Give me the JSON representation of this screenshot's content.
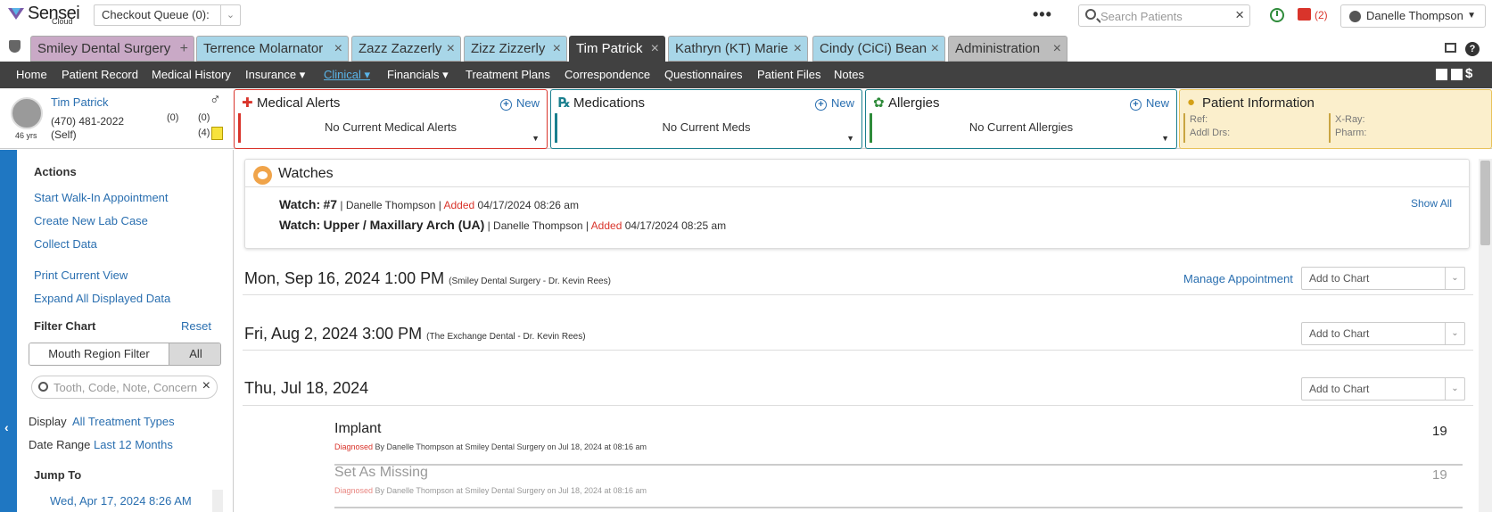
{
  "topbar": {
    "logo_text": "Sensei",
    "logo_sub": "Cloud",
    "queue_label": "Checkout Queue (0):",
    "search_placeholder": "Search Patients",
    "inbox_count": "(2)",
    "user_name": "Danelle Thompson"
  },
  "tabs": [
    {
      "label": "Smiley Dental Surgery",
      "close": "+"
    },
    {
      "label": "Terrence Molarnator",
      "close": "×"
    },
    {
      "label": "Zazz Zazzerly",
      "close": "×"
    },
    {
      "label": "Zizz Zizzerly",
      "close": "×"
    },
    {
      "label": "Tim Patrick",
      "close": "×"
    },
    {
      "label": "Kathryn (KT) Marie",
      "close": "×"
    },
    {
      "label": "Cindy (CiCi) Bean",
      "close": "×"
    },
    {
      "label": "Administration",
      "close": "×"
    }
  ],
  "nav": {
    "items": [
      "Home",
      "Patient Record",
      "Medical History",
      "Insurance ▾",
      "Clinical ▾",
      "Financials ▾",
      "Treatment Plans",
      "Correspondence",
      "Questionnaires",
      "Patient Files",
      "Notes"
    ],
    "dollar": "$",
    "help": "?"
  },
  "patient": {
    "name": "Tim Patrick",
    "phone": "(470) 481-2022",
    "relation": "(Self)",
    "age": "46 yrs",
    "gender_symbol": "♂",
    "count_a": "(0)",
    "count_b": "(0)",
    "count_c": "(4)"
  },
  "panels": {
    "alerts": {
      "title": "Medical Alerts",
      "new": "New",
      "body": "No Current Medical Alerts"
    },
    "meds": {
      "title": "Medications",
      "new": "New",
      "body": "No Current Meds"
    },
    "allergies": {
      "title": "Allergies",
      "new": "New",
      "body": "No Current Allergies"
    },
    "info": {
      "title": "Patient Information",
      "ref": "Ref:",
      "addl": "Addl Drs:",
      "xray": "X-Ray:",
      "pharm": "Pharm:"
    }
  },
  "sidebar": {
    "actions_heading": "Actions",
    "actions": [
      "Start Walk-In Appointment",
      "Create New Lab Case",
      "Collect Data",
      "Print Current View",
      "Expand All Displayed Data"
    ],
    "filter_heading": "Filter Chart",
    "reset": "Reset",
    "mouth_filter": "Mouth Region Filter",
    "all": "All",
    "filter_placeholder": "Tooth, Code, Note, Concern",
    "display_label": "Display",
    "display_value": "All Treatment Types",
    "range_label": "Date Range",
    "range_value": "Last 12 Months",
    "jump_heading": "Jump To",
    "jump_first": "Wed, Apr 17, 2024 8:26 AM"
  },
  "watches": {
    "title": "Watches",
    "show_all": "Show All",
    "rows": [
      {
        "label": "Watch:",
        "name": "#7",
        "by": " | Danelle Thompson | ",
        "added": "Added",
        "date": " 04/17/2024 08:26 am"
      },
      {
        "label": "Watch:",
        "name": "Upper / Maxillary Arch (UA)",
        "by": " | Danelle Thompson | ",
        "added": "Added",
        "date": " 04/17/2024 08:25 am"
      }
    ]
  },
  "appointments": [
    {
      "date": "Mon, Sep 16, 2024 1:00 PM",
      "loc": "(Smiley Dental Surgery - Dr. Kevin Rees)",
      "manage": "Manage Appointment",
      "add": "Add to Chart"
    },
    {
      "date": "Fri, Aug 2, 2024 3:00 PM",
      "loc": "(The Exchange Dental - Dr. Kevin Rees)",
      "add": "Add to Chart"
    },
    {
      "date": "Thu, Jul 18, 2024",
      "loc": "",
      "add": "Add to Chart"
    }
  ],
  "procedures": [
    {
      "name": "Implant",
      "dx": "Diagnosed",
      "by": " By Danelle Thompson at Smiley Dental Surgery on Jul 18, 2024 at 08:16 am",
      "tooth": "19"
    },
    {
      "name": "Set As Missing",
      "dx": "Diagnosed",
      "by": " By Danelle Thompson at Smiley Dental Surgery on Jul 18, 2024 at 08:16 am",
      "tooth": "19"
    }
  ],
  "colors": {
    "accent_blue": "#2a6fb0",
    "alert_red": "#d9342b",
    "nav_dark": "#414141"
  }
}
